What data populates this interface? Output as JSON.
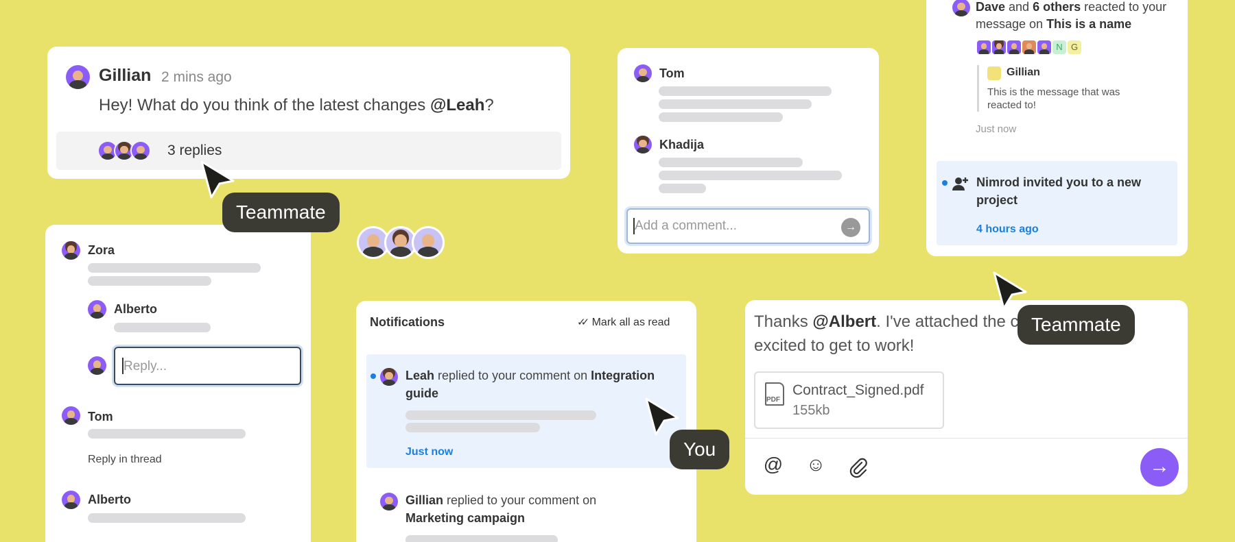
{
  "card_comment": {
    "author": "Gillian",
    "time": "2 mins ago",
    "message_before": "Hey! What do you think of the latest changes ",
    "mention": "@Leah",
    "message_after": "?",
    "replies": "3 replies"
  },
  "card_comments": {
    "user1": "Tom",
    "user2": "Khadija",
    "input_placeholder": "Add a comment..."
  },
  "card_activity": {
    "reaction_user": "Dave",
    "reaction_and": " and ",
    "reaction_count": "6 others",
    "reaction_text": " reacted to your message on ",
    "reaction_target": "This is a name",
    "letter_n": "N",
    "letter_g": "G",
    "quote_author": "Gillian",
    "quote_text": "This is the message that was reacted to!",
    "quote_time": "Just now",
    "invite_text": "Nimrod invited you to a new project",
    "invite_time": "4 hours ago"
  },
  "card_threads": {
    "user1": "Zora",
    "user2": "Alberto",
    "reply_placeholder": "Reply...",
    "user3": "Tom",
    "reply_in_thread": "Reply in thread",
    "user4": "Alberto"
  },
  "notifications": {
    "title": "Notifications",
    "mark_all": "Mark all as read",
    "n1_user": "Leah",
    "n1_text": " replied to your comment on ",
    "n1_target": "Integration guide",
    "n1_time": "Just now",
    "n2_user": "Gillian",
    "n2_text": " replied to your comment on ",
    "n2_target": "Marketing campaign"
  },
  "composer": {
    "msg_before": "Thanks ",
    "mention": "@Albert",
    "msg_after": ". I've attached the contract. Really excited to get to work!",
    "file_name": "Contract_Signed.pdf",
    "file_size": "155kb",
    "file_type": "PDF",
    "tool_mention": "@",
    "tool_emoji": "☺",
    "tool_attach": "📎",
    "send": "→"
  },
  "cursors": {
    "teammate1": "Teammate",
    "teammate2": "Teammate",
    "you": "You"
  },
  "colors": {
    "background": "#E9E26A",
    "accent": "#8b5cf6",
    "link": "#1b7fe0",
    "unread_bg": "#eaf3fd",
    "tag_bg": "#3b3a33"
  }
}
